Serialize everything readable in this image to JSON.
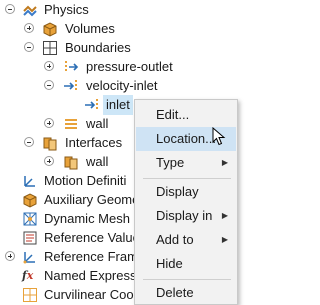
{
  "tree": {
    "physics": "Physics",
    "volumes": "Volumes",
    "boundaries": "Boundaries",
    "pressure_outlet": "pressure-outlet",
    "velocity_inlet": "velocity-inlet",
    "inlet": "inlet",
    "wall": "wall",
    "interfaces": "Interfaces",
    "interfaces_wall": "wall",
    "motion_definitions": "Motion Definiti",
    "auxiliary_geometry": "Auxiliary Geome",
    "dynamic_mesh": "Dynamic Mesh",
    "reference_values": "Reference Value",
    "reference_frames": "Reference Fram",
    "named_expressions": "Named Express",
    "curvilinear": "Curvilinear Coo"
  },
  "context_menu": {
    "edit": "Edit...",
    "location": "Location...",
    "type": "Type",
    "display": "Display",
    "display_in": "Display in",
    "add_to": "Add to",
    "hide": "Hide",
    "delete": "Delete",
    "submenu_arrow": "▶"
  },
  "icons": {
    "accent_orange": "#e8a23a",
    "accent_blue": "#2c6fb5"
  }
}
